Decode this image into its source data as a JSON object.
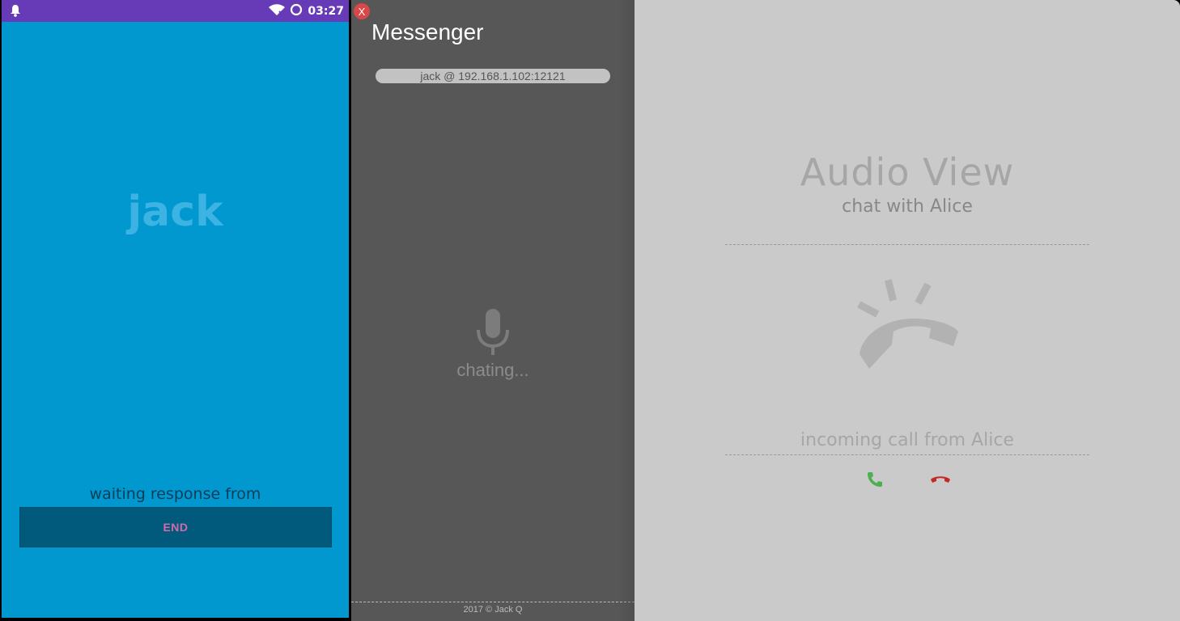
{
  "phone": {
    "status_time": "03:27",
    "caller_name": "jack",
    "waiting_text": "waiting response from",
    "end_label": "END"
  },
  "messenger": {
    "close_label": "X",
    "title": "Messenger",
    "peer": "jack @ 192.168.1.102:12121",
    "status": "chating...",
    "footer": "2017 © Jack Q"
  },
  "audio_view": {
    "title": "Audio View",
    "subtitle": "chat with Alice",
    "incoming_text": "incoming call from Alice"
  },
  "colors": {
    "phone_bg": "#0098cf",
    "status_bar": "#673ab7",
    "end_button": "#015a7c",
    "messenger_bg": "#575757",
    "audio_bg": "#cacaca",
    "accept": "#4caf50",
    "decline": "#c62828"
  }
}
